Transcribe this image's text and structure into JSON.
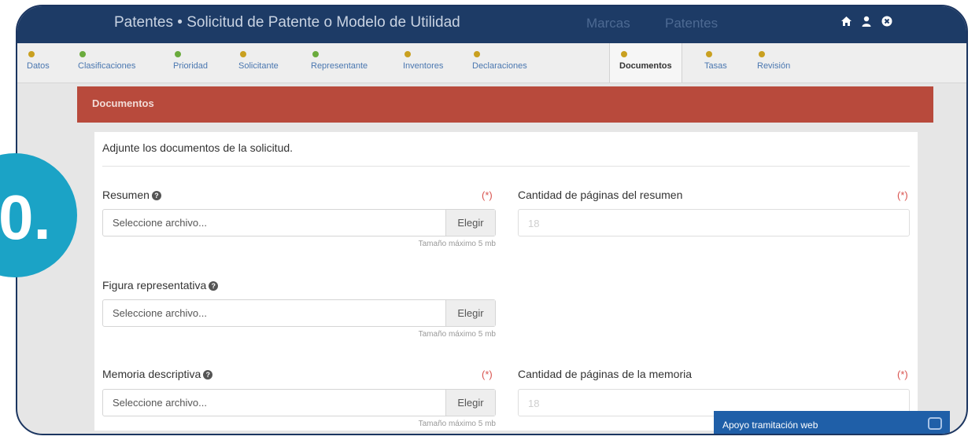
{
  "navbar": {
    "title": "Patentes • Solicitud de Patente o Modelo de Utilidad",
    "links": [
      "Marcas",
      "Patentes"
    ],
    "icons": [
      "home-icon",
      "user-icon",
      "close-circle-icon"
    ]
  },
  "steps": [
    {
      "label": "Datos",
      "status": "warn"
    },
    {
      "label": "Clasificaciones",
      "status": "ok"
    },
    {
      "label": "Prioridad",
      "status": "ok"
    },
    {
      "label": "Solicitante",
      "status": "warn"
    },
    {
      "label": "Representante",
      "status": "ok"
    },
    {
      "label": "Inventores",
      "status": "warn"
    },
    {
      "label": "Declaraciones",
      "status": "warn"
    },
    {
      "label": "Documentos",
      "status": "warn",
      "active": true
    },
    {
      "label": "Tasas",
      "status": "warn"
    },
    {
      "label": "Revisión",
      "status": "warn"
    }
  ],
  "panel": {
    "title": "Documentos",
    "intro": "Adjunte los documentos de la solicitud."
  },
  "fields": {
    "resumen": {
      "label": "Resumen",
      "required": "(*)",
      "placeholder": "Seleccione archivo...",
      "button": "Elegir",
      "hint": "Tamaño máximo 5 mb"
    },
    "paginas_resumen": {
      "label": "Cantidad de páginas del resumen",
      "required": "(*)",
      "value": "18"
    },
    "figura": {
      "label": "Figura representativa",
      "placeholder": "Seleccione archivo...",
      "button": "Elegir",
      "hint": "Tamaño máximo 5 mb"
    },
    "memoria": {
      "label": "Memoria descriptiva",
      "required": "(*)",
      "placeholder": "Seleccione archivo...",
      "button": "Elegir",
      "hint": "Tamaño máximo 5 mb"
    },
    "paginas_memoria": {
      "label": "Cantidad de páginas de la memoria",
      "required": "(*)",
      "value": "18"
    }
  },
  "chat": {
    "label": "Apoyo tramitación web"
  },
  "badge": {
    "text": "0."
  },
  "colors": {
    "navbar": "#1d3b66",
    "panel_header": "#b84a3c",
    "badge": "#1ba3c6",
    "chat": "#1f5fa8",
    "required": "#d9534f"
  }
}
